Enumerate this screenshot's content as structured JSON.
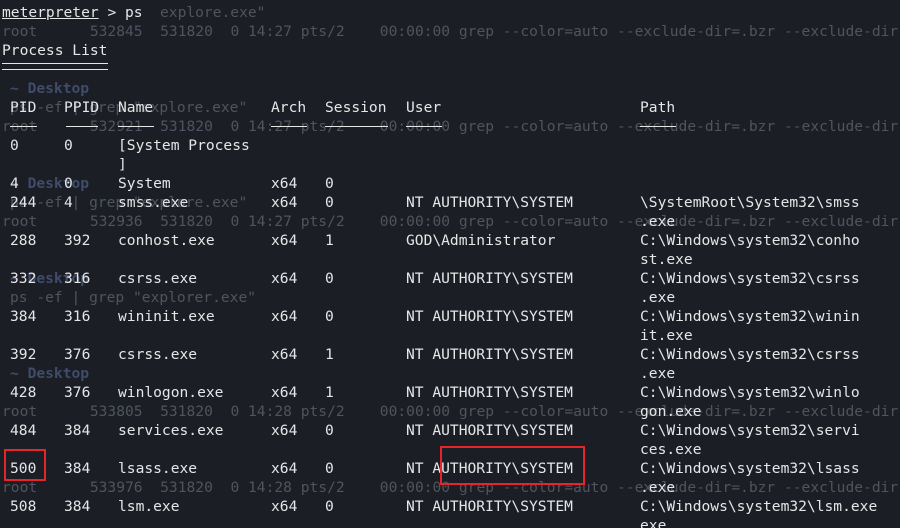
{
  "prompt": {
    "user": "meterpreter",
    "symbol": " > ",
    "command": "ps"
  },
  "title": "Process List",
  "headers": [
    "PID",
    "PPID",
    "Name",
    "Arch",
    "Session",
    "User",
    "Path"
  ],
  "rows": [
    {
      "pid": "0",
      "ppid": "0",
      "name": [
        "[System Process",
        "]"
      ],
      "arch": "",
      "session": "",
      "user": "",
      "path": []
    },
    {
      "pid": "4",
      "ppid": "0",
      "name": [
        "System"
      ],
      "arch": "x64",
      "session": "0",
      "user": "",
      "path": []
    },
    {
      "pid": "244",
      "ppid": "4",
      "name": [
        "smss.exe"
      ],
      "arch": "x64",
      "session": "0",
      "user": "NT AUTHORITY\\SYSTEM",
      "path": [
        "\\SystemRoot\\System32\\smss",
        ".exe"
      ]
    },
    {
      "pid": "288",
      "ppid": "392",
      "name": [
        "conhost.exe"
      ],
      "arch": "x64",
      "session": "1",
      "user": "GOD\\Administrator",
      "path": [
        "C:\\Windows\\system32\\conho",
        "st.exe"
      ]
    },
    {
      "pid": "332",
      "ppid": "316",
      "name": [
        "csrss.exe"
      ],
      "arch": "x64",
      "session": "0",
      "user": "NT AUTHORITY\\SYSTEM",
      "path": [
        "C:\\Windows\\system32\\csrss",
        ".exe"
      ]
    },
    {
      "pid": "384",
      "ppid": "316",
      "name": [
        "wininit.exe"
      ],
      "arch": "x64",
      "session": "0",
      "user": "NT AUTHORITY\\SYSTEM",
      "path": [
        "C:\\Windows\\system32\\winin",
        "it.exe"
      ]
    },
    {
      "pid": "392",
      "ppid": "376",
      "name": [
        "csrss.exe"
      ],
      "arch": "x64",
      "session": "1",
      "user": "NT AUTHORITY\\SYSTEM",
      "path": [
        "C:\\Windows\\system32\\csrss",
        ".exe"
      ]
    },
    {
      "pid": "428",
      "ppid": "376",
      "name": [
        "winlogon.exe"
      ],
      "arch": "x64",
      "session": "1",
      "user": "NT AUTHORITY\\SYSTEM",
      "path": [
        "C:\\Windows\\system32\\winlo",
        "gon.exe"
      ]
    },
    {
      "pid": "484",
      "ppid": "384",
      "name": [
        "services.exe"
      ],
      "arch": "x64",
      "session": "0",
      "user": "NT AUTHORITY\\SYSTEM",
      "path": [
        "C:\\Windows\\system32\\servi",
        "ces.exe"
      ]
    },
    {
      "pid": "500",
      "ppid": "384",
      "name": [
        "lsass.exe"
      ],
      "arch": "x64",
      "session": "0",
      "user": "NT AUTHORITY\\SYSTEM",
      "path": [
        "C:\\Windows\\system32\\lsass",
        ".exe"
      ]
    },
    {
      "pid": "508",
      "ppid": "384",
      "name": [
        "lsm.exe"
      ],
      "arch": "x64",
      "session": "0",
      "user": "NT AUTHORITY\\SYSTEM",
      "path": [
        "C:\\Windows\\system32\\lsm.exe",
        "exe"
      ]
    }
  ],
  "background": {
    "explore": "explore.exe\"",
    "grep1": "root      532845  531820  0 14:27 pts/2    00:00:00 grep --color=auto --exclude-dir=.bzr --exclude-dir",
    "desktop": "~ Desktop",
    "grepcmd": "ps -ef | grep \"explore.exe\"",
    "grep2": "root      532921  531820  0 14:27 pts/2    00:00:00 grep --color=auto --exclude-dir=.bzr --exclude-dir",
    "grepcmd2": "ps -ef | grep \"explore.exe\"",
    "grep3": "root      532936  531820  0 14:27 pts/2    00:00:00 grep --color=auto --exclude-dir=.bzr --exclude-dir",
    "grepcmd3": "ps -ef | grep \"explorer.exe\"",
    "grep4": "root      533805  531820  0 14:28 pts/2    00:00:00 grep --color=auto --exclude-dir=.bzr --exclude-dir",
    "grep5": "root      533976  531820  0 14:28 pts/2    00:00:00 grep --color=auto --exclude-dir=.bzr --exclude-dir"
  },
  "colors": {
    "background": "#1c1e26",
    "text": "#e6e6e6",
    "highlight_box": "#e5252a"
  }
}
